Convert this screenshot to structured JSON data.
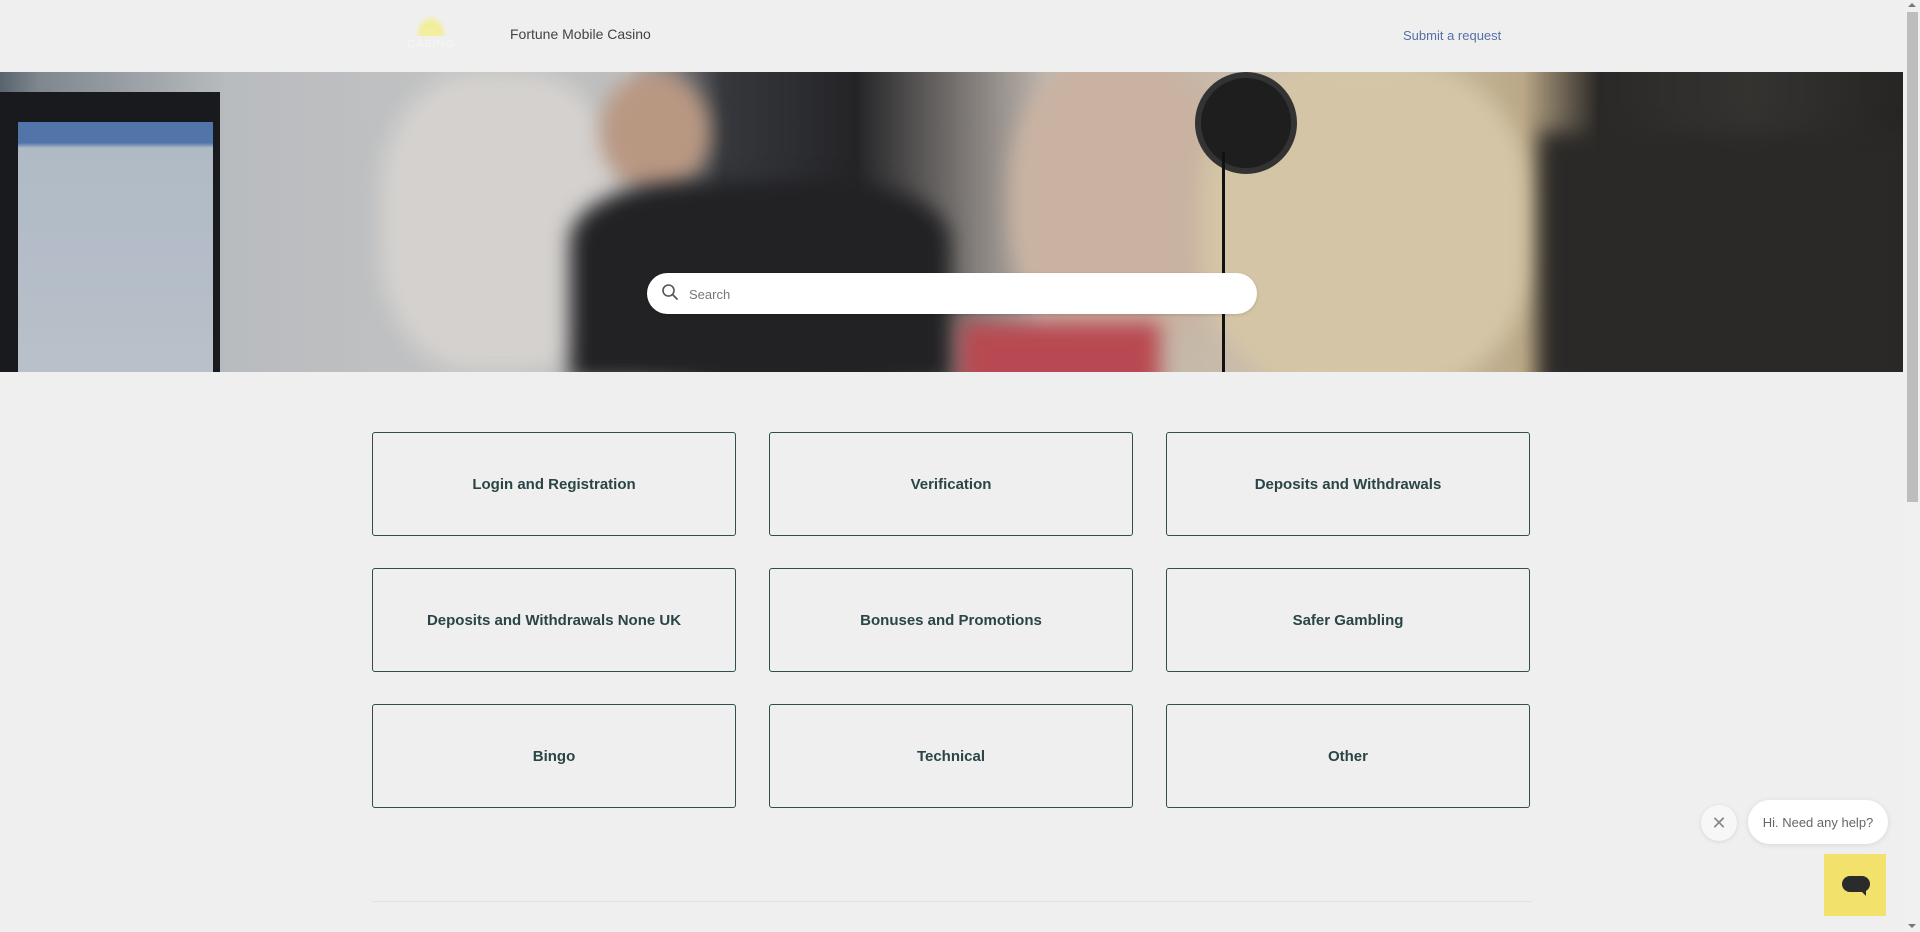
{
  "header": {
    "logo_text": "CASINO",
    "brand_name": "Fortune Mobile Casino",
    "submit_request": "Submit a request"
  },
  "hero": {
    "search": {
      "placeholder": "Search",
      "value": ""
    }
  },
  "categories": [
    {
      "label": "Login and Registration"
    },
    {
      "label": "Verification"
    },
    {
      "label": "Deposits and Withdrawals"
    },
    {
      "label": "Deposits and Withdrawals None UK"
    },
    {
      "label": "Bonuses and Promotions"
    },
    {
      "label": "Safer Gambling"
    },
    {
      "label": "Bingo"
    },
    {
      "label": "Technical"
    },
    {
      "label": "Other"
    }
  ],
  "chat": {
    "close_symbol": "✕",
    "greeting": "Hi. Need any help?",
    "launcher_color": "#f2e16b"
  },
  "colors": {
    "category_text": "#2a4545",
    "link": "#5470a8",
    "background": "#efefef"
  }
}
